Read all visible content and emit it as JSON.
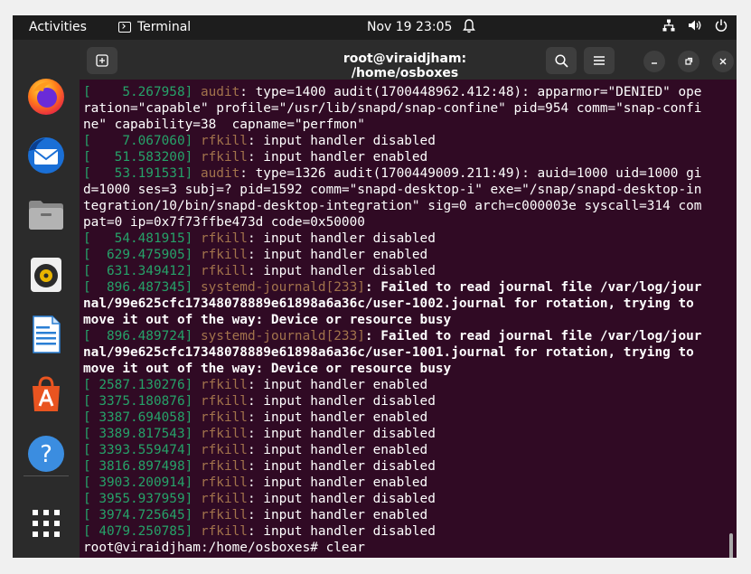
{
  "topbar": {
    "activities": "Activities",
    "app_name": "Terminal",
    "clock": "Nov 19  23:05"
  },
  "dock": {
    "items": [
      "firefox-icon",
      "thunderbird-icon",
      "files-icon",
      "rhythmbox-icon",
      "libreoffice-writer-icon",
      "app-center-icon",
      "help-icon",
      "show-apps-icon"
    ]
  },
  "window": {
    "title": "root@viraidjham: /home/osboxes"
  },
  "terminal": {
    "lines": [
      [
        {
          "t": "[    5.267958] ",
          "c": "ts"
        },
        {
          "t": "audit",
          "c": "src"
        },
        {
          "t": ": type=1400 audit(1700448962.412:48): apparmor=\"DENIED\" ope"
        }
      ],
      [
        {
          "t": "ration=\"capable\" profile=\"/usr/lib/snapd/snap-confine\" pid=954 comm=\"snap-confi"
        }
      ],
      [
        {
          "t": "ne\" capability=38  capname=\"perfmon\""
        }
      ],
      [
        {
          "t": "[    7.067060] ",
          "c": "ts"
        },
        {
          "t": "rfkill",
          "c": "src"
        },
        {
          "t": ": input handler disabled"
        }
      ],
      [
        {
          "t": "[   51.583200] ",
          "c": "ts"
        },
        {
          "t": "rfkill",
          "c": "src"
        },
        {
          "t": ": input handler enabled"
        }
      ],
      [
        {
          "t": "[   53.191531] ",
          "c": "ts"
        },
        {
          "t": "audit",
          "c": "src"
        },
        {
          "t": ": type=1326 audit(1700449009.211:49): auid=1000 uid=1000 gi"
        }
      ],
      [
        {
          "t": "d=1000 ses=3 subj=? pid=1592 comm=\"snapd-desktop-i\" exe=\"/snap/snapd-desktop-in"
        }
      ],
      [
        {
          "t": "tegration/10/bin/snapd-desktop-integration\" sig=0 arch=c000003e syscall=314 com"
        }
      ],
      [
        {
          "t": "pat=0 ip=0x7f73ffbe473d code=0x50000"
        }
      ],
      [
        {
          "t": "[   54.481915] ",
          "c": "ts"
        },
        {
          "t": "rfkill",
          "c": "src"
        },
        {
          "t": ": input handler disabled"
        }
      ],
      [
        {
          "t": "[  629.475905] ",
          "c": "ts"
        },
        {
          "t": "rfkill",
          "c": "src"
        },
        {
          "t": ": input handler enabled"
        }
      ],
      [
        {
          "t": "[  631.349412] ",
          "c": "ts"
        },
        {
          "t": "rfkill",
          "c": "src"
        },
        {
          "t": ": input handler disabled"
        }
      ],
      [
        {
          "t": "[  896.487345] ",
          "c": "ts"
        },
        {
          "t": "systemd-journald[233]",
          "c": "src"
        },
        {
          "t": ": Failed to read journal file /var/log/jour",
          "c": "b"
        }
      ],
      [
        {
          "t": "nal/99e625cfc17348078889e61898a6a36c/user-1002.journal for rotation, trying to",
          "c": "b"
        }
      ],
      [
        {
          "t": "move it out of the way: Device or resource busy",
          "c": "b"
        }
      ],
      [
        {
          "t": "[  896.489724] ",
          "c": "ts"
        },
        {
          "t": "systemd-journald[233]",
          "c": "src"
        },
        {
          "t": ": Failed to read journal file /var/log/jour",
          "c": "b"
        }
      ],
      [
        {
          "t": "nal/99e625cfc17348078889e61898a6a36c/user-1001.journal for rotation, trying to",
          "c": "b"
        }
      ],
      [
        {
          "t": "move it out of the way: Device or resource busy",
          "c": "b"
        }
      ],
      [
        {
          "t": "[ 2587.130276] ",
          "c": "ts"
        },
        {
          "t": "rfkill",
          "c": "src"
        },
        {
          "t": ": input handler enabled"
        }
      ],
      [
        {
          "t": "[ 3375.180876] ",
          "c": "ts"
        },
        {
          "t": "rfkill",
          "c": "src"
        },
        {
          "t": ": input handler disabled"
        }
      ],
      [
        {
          "t": "[ 3387.694058] ",
          "c": "ts"
        },
        {
          "t": "rfkill",
          "c": "src"
        },
        {
          "t": ": input handler enabled"
        }
      ],
      [
        {
          "t": "[ 3389.817543] ",
          "c": "ts"
        },
        {
          "t": "rfkill",
          "c": "src"
        },
        {
          "t": ": input handler disabled"
        }
      ],
      [
        {
          "t": "[ 3393.559474] ",
          "c": "ts"
        },
        {
          "t": "rfkill",
          "c": "src"
        },
        {
          "t": ": input handler enabled"
        }
      ],
      [
        {
          "t": "[ 3816.897498] ",
          "c": "ts"
        },
        {
          "t": "rfkill",
          "c": "src"
        },
        {
          "t": ": input handler disabled"
        }
      ],
      [
        {
          "t": "[ 3903.200914] ",
          "c": "ts"
        },
        {
          "t": "rfkill",
          "c": "src"
        },
        {
          "t": ": input handler enabled"
        }
      ],
      [
        {
          "t": "[ 3955.937959] ",
          "c": "ts"
        },
        {
          "t": "rfkill",
          "c": "src"
        },
        {
          "t": ": input handler disabled"
        }
      ],
      [
        {
          "t": "[ 3974.725645] ",
          "c": "ts"
        },
        {
          "t": "rfkill",
          "c": "src"
        },
        {
          "t": ": input handler enabled"
        }
      ],
      [
        {
          "t": "[ 4079.250785] ",
          "c": "ts"
        },
        {
          "t": "rfkill",
          "c": "src"
        },
        {
          "t": ": input handler disabled"
        }
      ],
      [
        {
          "t": "root@viraidjham:/home/osboxes# clear"
        }
      ]
    ]
  },
  "colors": {
    "terminal_bg": "#300a24",
    "timestamp": "#26a269",
    "source": "#a2734c"
  }
}
